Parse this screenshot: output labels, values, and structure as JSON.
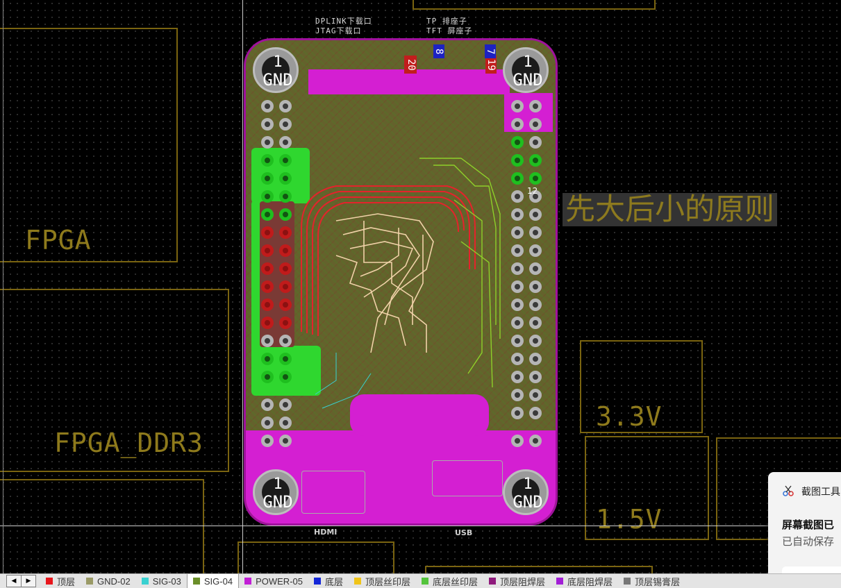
{
  "canvas": {
    "box_labels": {
      "fpga": "FPGA",
      "fpga_ddr3": "FPGA_DDR3",
      "v33": "3.3V",
      "v15": "1.5V"
    },
    "annotation": "先大后小的原则",
    "silkscreen": {
      "dplink": "DPLINK下载口",
      "jtag": "JTAG下载口",
      "tp": "TP 排座子",
      "tft": "TFT 屏座子",
      "hdmi": "HDMI",
      "usb": "USB",
      "pin_12": "12"
    },
    "chips": {
      "c20": "20",
      "c8": "8",
      "c19": "19",
      "c7": "7"
    },
    "mount_holes": [
      {
        "num": "1",
        "label": "GND"
      },
      {
        "num": "1",
        "label": "GND"
      },
      {
        "num": "1",
        "label": "GND"
      },
      {
        "num": "1",
        "label": "GND"
      }
    ],
    "colors": {
      "board_outline": "#a0119d",
      "keepout": "#7a6410",
      "magenta_pour": "#d41fd2",
      "green_pour": "#2fd72f"
    }
  },
  "layer_tabs": [
    {
      "label": "顶层",
      "color": "#e8161c",
      "active": false
    },
    {
      "label": "GND-02",
      "color": "#9a9a66",
      "active": false
    },
    {
      "label": "SIG-03",
      "color": "#3ad1d1",
      "active": false
    },
    {
      "label": "SIG-04",
      "color": "#6b8f2a",
      "active": true
    },
    {
      "label": "POWER-05",
      "color": "#c21fd6",
      "active": false
    },
    {
      "label": "底层",
      "color": "#1427d8",
      "active": false
    },
    {
      "label": "顶层丝印层",
      "color": "#f0c419",
      "active": false
    },
    {
      "label": "底层丝印层",
      "color": "#54c43c",
      "active": false
    },
    {
      "label": "顶层阻焊层",
      "color": "#8f1a7c",
      "active": false
    },
    {
      "label": "底层阻焊层",
      "color": "#a21fd6",
      "active": false
    },
    {
      "label": "顶层锡膏层",
      "color": "#777777",
      "active": false
    }
  ],
  "notification": {
    "app": "截图工具",
    "title": "屏幕截图已",
    "body": "已自动保存"
  }
}
